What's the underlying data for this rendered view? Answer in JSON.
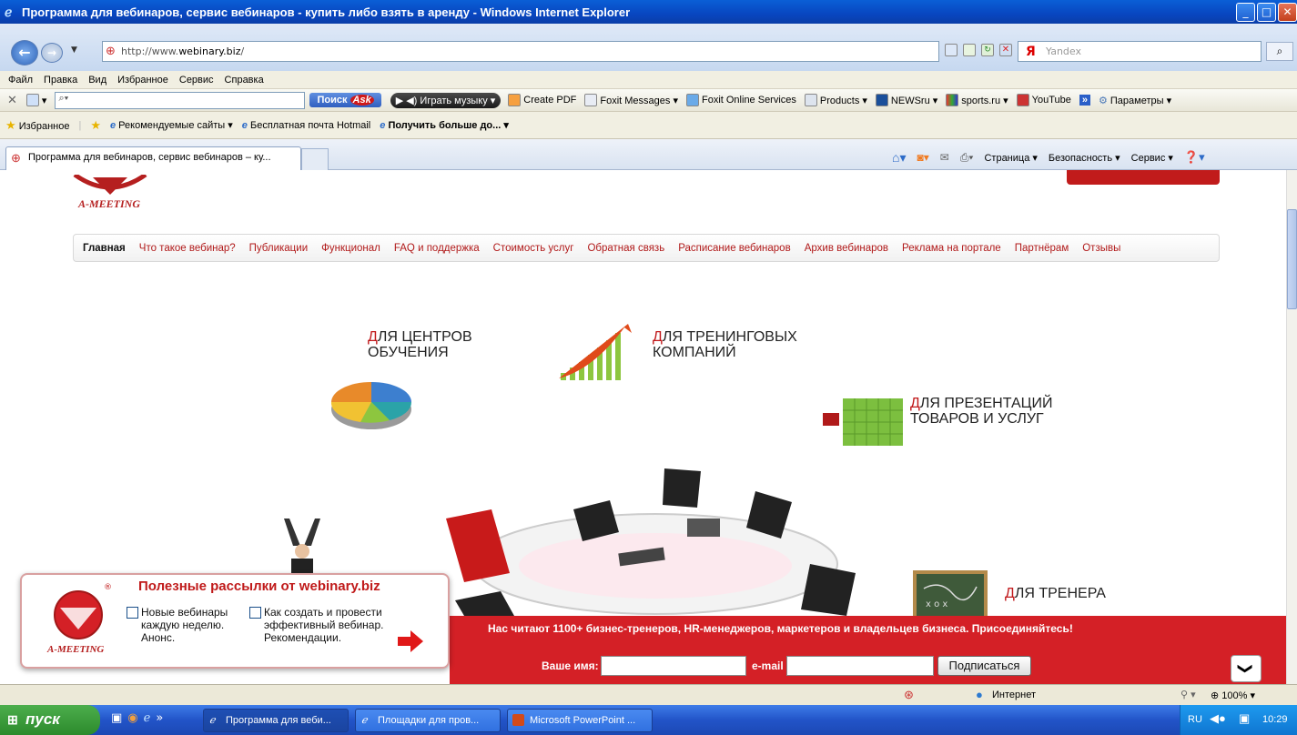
{
  "window": {
    "title": "Программа для вебинаров, сервис вебинаров - купить либо взять в аренду - Windows Internet Explorer",
    "min": "_",
    "max": "□",
    "close": "✕"
  },
  "address": {
    "url_prefix": "http://www.",
    "url_domain": "webinary.biz",
    "url_suffix": "/",
    "search_placeholder": "Yandex",
    "search_brand": "Я"
  },
  "menu": [
    "Файл",
    "Правка",
    "Вид",
    "Избранное",
    "Сервис",
    "Справка"
  ],
  "toolbar": {
    "search_button": "Поиск",
    "ask_logo": "Ask",
    "music_button": "Играть музыку",
    "items": [
      "Create PDF",
      "Foxit Messages ▾",
      "Foxit Online Services",
      "Products ▾",
      "NEWSru ▾",
      "sports.ru ▾",
      "YouTube"
    ],
    "more": "»",
    "settings": "Параметры ▾"
  },
  "favorites": {
    "label": "Избранное",
    "items": [
      "Рекомендуемые сайты ▾",
      "Бесплатная почта Hotmail",
      "Получить больше до... ▾"
    ]
  },
  "tab": {
    "title": "Программа для вебинаров, сервис вебинаров – ку..."
  },
  "command_bar": [
    "Страница ▾",
    "Безопасность ▾",
    "Сервис ▾"
  ],
  "site": {
    "logo_text": "A-MEETING",
    "nav": [
      "Главная",
      "Что такое вебинар?",
      "Публикации",
      "Функционал",
      "FAQ и поддержка",
      "Стоимость услуг",
      "Обратная связь",
      "Расписание вебинаров",
      "Архив вебинаров",
      "Реклама на портале",
      "Партнёрам",
      "Отзывы"
    ],
    "categories": {
      "centers": {
        "first": "Д",
        "rest1": "ля центров",
        "line2": "обучения"
      },
      "trainings": {
        "first": "Д",
        "rest1": "ля тренинговых",
        "line2": "компаний"
      },
      "presentations": {
        "first": "Д",
        "rest1": "ля презентаций",
        "line2": "товаров и услуг"
      },
      "trainer": {
        "first": "Д",
        "rest1": "ля тренера"
      }
    }
  },
  "newsletter": {
    "title": "Полезные рассылки от webinary.biz",
    "registered": "®",
    "logo_text": "A-MEETING",
    "option1": [
      "Новые вебинары",
      "каждую неделю.",
      "Анонс."
    ],
    "option2": [
      "Как создать и провести",
      "эффективный вебинар.",
      "Рекомендации."
    ],
    "band_text": "Нас читают 1100+ бизнес-тренеров, HR-менеджеров, маркетеров и владельцев бизнеса. Присоединяйтесь!",
    "name_label": "Ваше имя:",
    "email_label": "e-mail",
    "subscribe": "Подписаться",
    "chevron": "❯"
  },
  "status": {
    "zone": "Интернет",
    "zoom": "100%"
  },
  "taskbar": {
    "start": "пуск",
    "tasks": [
      "Программа для веби...",
      "Площадки для пров...",
      "Microsoft PowerPoint ..."
    ],
    "lang": "RU",
    "time": "10:29"
  }
}
